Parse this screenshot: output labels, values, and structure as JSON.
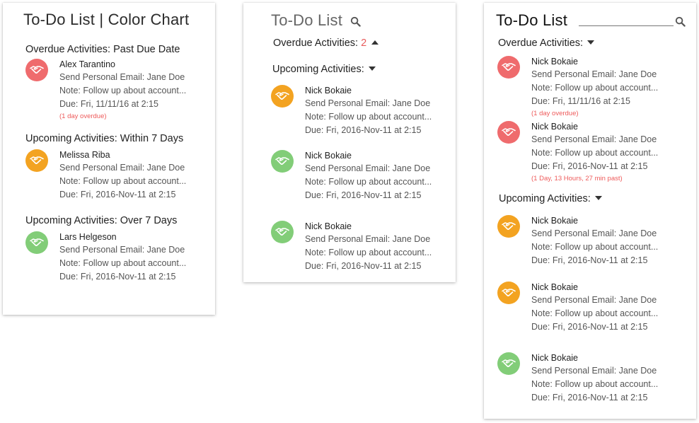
{
  "panel1": {
    "title": "To-Do List | Color Chart",
    "sections": [
      {
        "label": "Overdue Activities: Past Due Date",
        "items": [
          {
            "color": "red",
            "name": "Alex Tarantino",
            "email": "Send Personal Email: Jane Doe",
            "note": "Note: Follow up about account...",
            "due": "Due: Fri, 11/11/16 at 2:15",
            "overdue": "(1 day overdue)"
          }
        ]
      },
      {
        "label": "Upcoming Activities: Within 7 Days",
        "items": [
          {
            "color": "orange",
            "name": "Melissa Riba",
            "email": "Send Personal Email: Jane Doe",
            "note": "Note: Follow up about account...",
            "due": "Due: Fri, 2016-Nov-11 at 2:15"
          }
        ]
      },
      {
        "label": "Upcoming Activities: Over 7 Days",
        "items": [
          {
            "color": "green",
            "name": "Lars Helgeson",
            "email": "Send Personal Email: Jane Doe",
            "note": "Note: Follow up about account...",
            "due": "Due: Fri, 2016-Nov-11 at 2:15"
          }
        ]
      }
    ]
  },
  "panel2": {
    "title": "To-Do List",
    "overdue_label": "Overdue Activities:",
    "overdue_count": "2",
    "upcoming_label": "Upcoming Activities:",
    "items": [
      {
        "color": "orange",
        "name": "Nick Bokaie",
        "email": "Send Personal Email: Jane Doe",
        "note": "Note: Follow up about account...",
        "due": "Due: Fri, 2016-Nov-11 at 2:15"
      },
      {
        "color": "green",
        "name": "Nick Bokaie",
        "email": "Send Personal Email: Jane Doe",
        "note": "Note: Follow up about account...",
        "due": "Due: Fri, 2016-Nov-11 at 2:15"
      },
      {
        "color": "green",
        "name": "Nick Bokaie",
        "email": "Send Personal Email: Jane Doe",
        "note": "Note: Follow up about account...",
        "due": "Due: Fri, 2016-Nov-11 at 2:15"
      }
    ]
  },
  "panel3": {
    "title": "To-Do List",
    "search_value": "",
    "overdue_label": "Overdue Activities:",
    "upcoming_label": "Upcoming Activities:",
    "overdue_items": [
      {
        "color": "red",
        "name": "Nick Bokaie",
        "email": "Send Personal Email: Jane Doe",
        "note": "Note: Follow up about account...",
        "due": "Due: Fri, 11/11/16 at 2:15",
        "overdue": "(1 day overdue)"
      },
      {
        "color": "red",
        "name": "Nick Bokaie",
        "email": "Send Personal Email: Jane Doe",
        "note": "Note: Follow up about account...",
        "due": "Due: Fri, 2016-Nov-11 at 2:15",
        "overdue": "(1 Day, 13 Hours, 27 min past)"
      }
    ],
    "upcoming_items": [
      {
        "color": "orange",
        "name": "Nick Bokaie",
        "email": "Send Personal Email: Jane Doe",
        "note": "Note: Follow up about account...",
        "due": "Due: Fri, 2016-Nov-11 at 2:15"
      },
      {
        "color": "orange",
        "name": "Nick Bokaie",
        "email": "Send Personal Email: Jane Doe",
        "note": "Note: Follow up about account...",
        "due": "Due: Fri, 2016-Nov-11 at 2:15"
      },
      {
        "color": "green",
        "name": "Nick Bokaie",
        "email": "Send Personal Email: Jane Doe",
        "note": "Note: Follow up about account...",
        "due": "Due: Fri, 2016-Nov-11 at 2:15"
      }
    ]
  },
  "colors": {
    "red": "#ef6b6d",
    "orange": "#f3a321",
    "green": "#82cd78",
    "overdue_text": "#ee5a5a"
  },
  "icons": {
    "activity": "handshake-icon",
    "search": "search-icon",
    "expand": "caret-down-icon",
    "collapse": "caret-up-icon"
  }
}
